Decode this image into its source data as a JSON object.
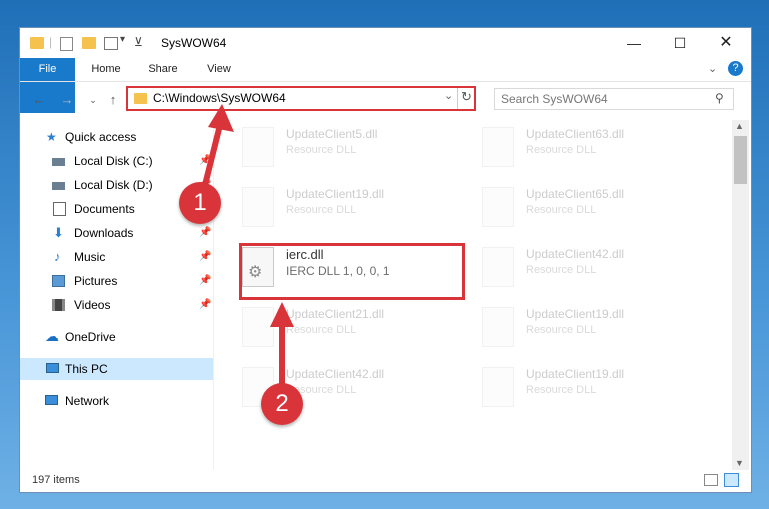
{
  "window": {
    "title": "SysWOW64"
  },
  "ribbon": {
    "tabs": [
      "File",
      "Home",
      "Share",
      "View"
    ]
  },
  "address": {
    "path": "C:\\Windows\\SysWOW64",
    "search_placeholder": "Search SysWOW64"
  },
  "nav": {
    "items": [
      {
        "label": "Quick access"
      },
      {
        "label": "Local Disk (C:)"
      },
      {
        "label": "Local Disk (D:)"
      },
      {
        "label": "Documents"
      },
      {
        "label": "Downloads"
      },
      {
        "label": "Music"
      },
      {
        "label": "Pictures"
      },
      {
        "label": "Videos"
      },
      {
        "label": "OneDrive"
      },
      {
        "label": "This PC"
      },
      {
        "label": "Network"
      }
    ]
  },
  "files": {
    "left": [
      {
        "name": "UpdateClient5.dll",
        "type": "Resource DLL"
      },
      {
        "name": "UpdateClient19.dll",
        "type": "Resource DLL"
      },
      {
        "name": "ierc.dll",
        "type": "IERC DLL 1, 0, 0, 1"
      },
      {
        "name": "UpdateClient21.dll",
        "type": "Resource DLL"
      },
      {
        "name": "UpdateClient42.dll",
        "type": "Resource DLL"
      }
    ],
    "right": [
      {
        "name": "UpdateClient63.dll",
        "type": "Resource DLL"
      },
      {
        "name": "UpdateClient65.dll",
        "type": "Resource DLL"
      },
      {
        "name": "UpdateClient42.dll",
        "type": "Resource DLL"
      },
      {
        "name": "UpdateClient19.dll",
        "type": "Resource DLL"
      },
      {
        "name": "UpdateClient19.dll",
        "type": "Resource DLL"
      }
    ]
  },
  "status": {
    "count": "197 items"
  },
  "callouts": {
    "one": "1",
    "two": "2"
  },
  "colors": {
    "accent": "#1979ca",
    "highlight": "#d9343a",
    "selection": "#cce8ff"
  }
}
